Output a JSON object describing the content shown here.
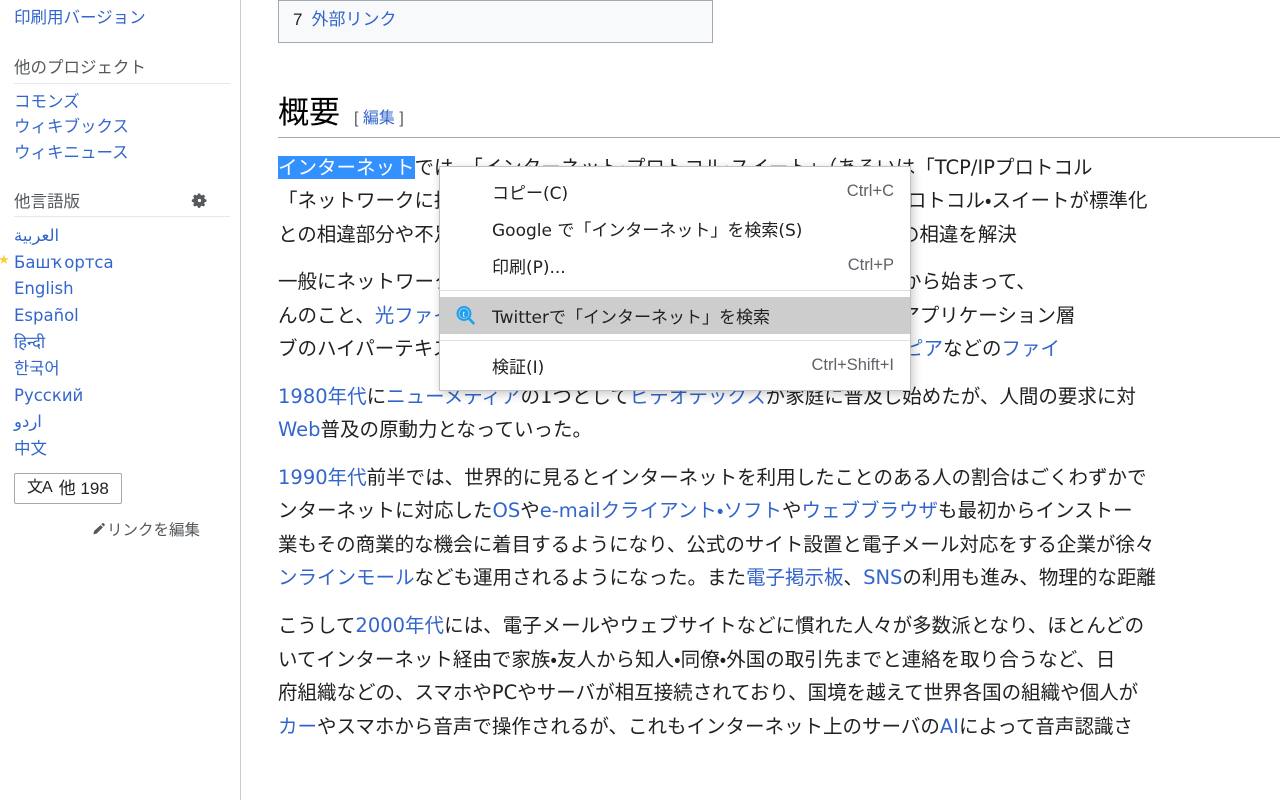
{
  "sidebar": {
    "print_version_label": "印刷用バージョン",
    "other_projects": {
      "heading": "他のプロジェクト",
      "items": [
        {
          "label": "コモンズ"
        },
        {
          "label": "ウィキブックス"
        },
        {
          "label": "ウィキニュース"
        }
      ]
    },
    "languages": {
      "heading": "他言語版",
      "settings_icon": "gear-icon",
      "items": [
        {
          "label": "العربية",
          "featured": false
        },
        {
          "label": "Башҡортса",
          "featured": true
        },
        {
          "label": "English",
          "featured": false
        },
        {
          "label": "Español",
          "featured": false
        },
        {
          "label": "हिन्दी",
          "featured": false
        },
        {
          "label": "한국어",
          "featured": false
        },
        {
          "label": "Русский",
          "featured": false
        },
        {
          "label": "اردو",
          "featured": false
        },
        {
          "label": "中文",
          "featured": false
        }
      ],
      "more_button": {
        "icon": "language-badge-icon",
        "icon_text": "文A",
        "label": "他 198"
      },
      "edit_links": {
        "icon": "pencil-icon",
        "label": "リンクを編集"
      }
    }
  },
  "content": {
    "toc": {
      "number": "7",
      "label": "外部リンク"
    },
    "section": {
      "title": "概要",
      "edit_bracket_open": "[",
      "edit_label": "編集",
      "edit_bracket_close": "]"
    },
    "paragraphs": [
      {
        "lines": [
          {
            "parts": [
              {
                "text": "インターネット",
                "style": "selected"
              },
              {
                "text": "では、「インターネット・プロトコル・スイート」（あるいは「TCP/IPプロトコル",
                "style": "plain"
              }
            ]
          },
          {
            "parts": [
              {
                "text": "「ネットワークに接続する機器の仕様にかかわらず、インターネット・プロトコル・スイートが標準化",
                "style": "plain"
              }
            ]
          },
          {
            "parts": [
              {
                "text": "との相違部分や不足部分が標準仕様として規定されているおかげで、その相違を解決",
                "style": "plain"
              }
            ]
          }
        ]
      },
      {
        "lines": [
          {
            "parts": [
              {
                "text": "一般にネットワークの階層構造の最下位層（物理媒体）（＝「物理層」）から始まって、",
                "style": "plain"
              }
            ]
          },
          {
            "parts": [
              {
                "text": "んのこと、",
                "style": "plain"
              },
              {
                "text": "光ファイバ",
                "style": "link"
              },
              {
                "text": "なども用いられている。階層構造の最上位層の「アプリケーション層",
                "style": "plain"
              }
            ]
          },
          {
            "parts": [
              {
                "text": "ブのハイパーテキスト転送のためのHTTPなどがあり、後に、",
                "style": "plain"
              },
              {
                "text": "ピア・トゥ・ピア",
                "style": "link"
              },
              {
                "text": "などの",
                "style": "plain"
              },
              {
                "text": "ファイ",
                "style": "link"
              }
            ]
          }
        ]
      },
      {
        "lines": [
          {
            "parts": [
              {
                "text": "1980年代",
                "style": "link"
              },
              {
                "text": "に",
                "style": "plain"
              },
              {
                "text": "ニューメディア",
                "style": "link"
              },
              {
                "text": "の1つとして",
                "style": "plain"
              },
              {
                "text": "ビデオテックス",
                "style": "link"
              },
              {
                "text": "が家庭に普及し始めたが、人間の要求に対",
                "style": "plain"
              }
            ]
          },
          {
            "parts": [
              {
                "text": "Web",
                "style": "link"
              },
              {
                "text": "普及の原動力となっていった。",
                "style": "plain"
              }
            ]
          }
        ]
      },
      {
        "lines": [
          {
            "parts": [
              {
                "text": "1990年代",
                "style": "link"
              },
              {
                "text": "前半では、世界的に見るとインターネットを利用したことのある人の割合はごくわずかで",
                "style": "plain"
              }
            ]
          },
          {
            "parts": [
              {
                "text": "ンターネットに対応した",
                "style": "plain"
              },
              {
                "text": "OS",
                "style": "link"
              },
              {
                "text": "や",
                "style": "plain"
              },
              {
                "text": "e-mail",
                "style": "link"
              },
              {
                "text": "クライアント・ソフト",
                "style": "link"
              },
              {
                "text": "や",
                "style": "plain"
              },
              {
                "text": "ウェブブラウザ",
                "style": "link"
              },
              {
                "text": "も最初からインストー",
                "style": "plain"
              }
            ]
          },
          {
            "parts": [
              {
                "text": "業もその商業的な機会に着目するようになり、公式のサイト設置と電子メール対応をする企業が徐々",
                "style": "plain"
              }
            ]
          },
          {
            "parts": [
              {
                "text": "ンラインモール",
                "style": "link"
              },
              {
                "text": "なども運用されるようになった。また",
                "style": "plain"
              },
              {
                "text": "電子掲示板",
                "style": "link"
              },
              {
                "text": "、",
                "style": "plain"
              },
              {
                "text": "SNS",
                "style": "link"
              },
              {
                "text": "の利用も進み、物理的な距離",
                "style": "plain"
              }
            ]
          }
        ]
      },
      {
        "lines": [
          {
            "parts": [
              {
                "text": "こうして",
                "style": "plain"
              },
              {
                "text": "2000年代",
                "style": "link"
              },
              {
                "text": "には、電子メールやウェブサイトなどに慣れた人々が多数派となり、ほとんどの",
                "style": "plain"
              }
            ]
          },
          {
            "parts": [
              {
                "text": "いてインターネット経由で家族・友人から知人・同僚・外国の取引先までと連絡を取り合うなど、日",
                "style": "plain"
              }
            ]
          },
          {
            "parts": [
              {
                "text": "府組織などの、スマホやPCやサーバが相互接続されており、国境を越えて世界各国の組織や個人が",
                "style": "plain"
              }
            ]
          },
          {
            "parts": [
              {
                "text": "カー",
                "style": "link"
              },
              {
                "text": "やスマホから音声で操作されるが、これもインターネット上のサーバの",
                "style": "plain"
              },
              {
                "text": "AI",
                "style": "link"
              },
              {
                "text": "によって音声認識さ",
                "style": "plain"
              }
            ]
          }
        ]
      }
    ]
  },
  "context_menu": {
    "items": [
      {
        "type": "item",
        "label": "コピー(C)",
        "accel": "Ctrl+C",
        "icon": null,
        "highlighted": false
      },
      {
        "type": "item",
        "label": "Google で「インターネット」を検索(S)",
        "accel": "",
        "icon": null,
        "highlighted": false
      },
      {
        "type": "item",
        "label": "印刷(P)...",
        "accel": "Ctrl+P",
        "icon": null,
        "highlighted": false
      },
      {
        "type": "separator"
      },
      {
        "type": "item",
        "label": "Twitterで「インターネット」を検索",
        "accel": "",
        "icon": "twitter-search-icon",
        "highlighted": true
      },
      {
        "type": "separator"
      },
      {
        "type": "item",
        "label": "検証(I)",
        "accel": "Ctrl+Shift+I",
        "icon": null,
        "highlighted": false
      }
    ]
  },
  "colors": {
    "link": "#3366cc",
    "selection_bg": "#3390ff",
    "selection_fg": "#ffffff",
    "menu_highlight": "#cdcdcd",
    "twitter_blue": "#1da1f2",
    "featured_star": "#ffcc33",
    "toc_bg": "#f8f9fa"
  }
}
